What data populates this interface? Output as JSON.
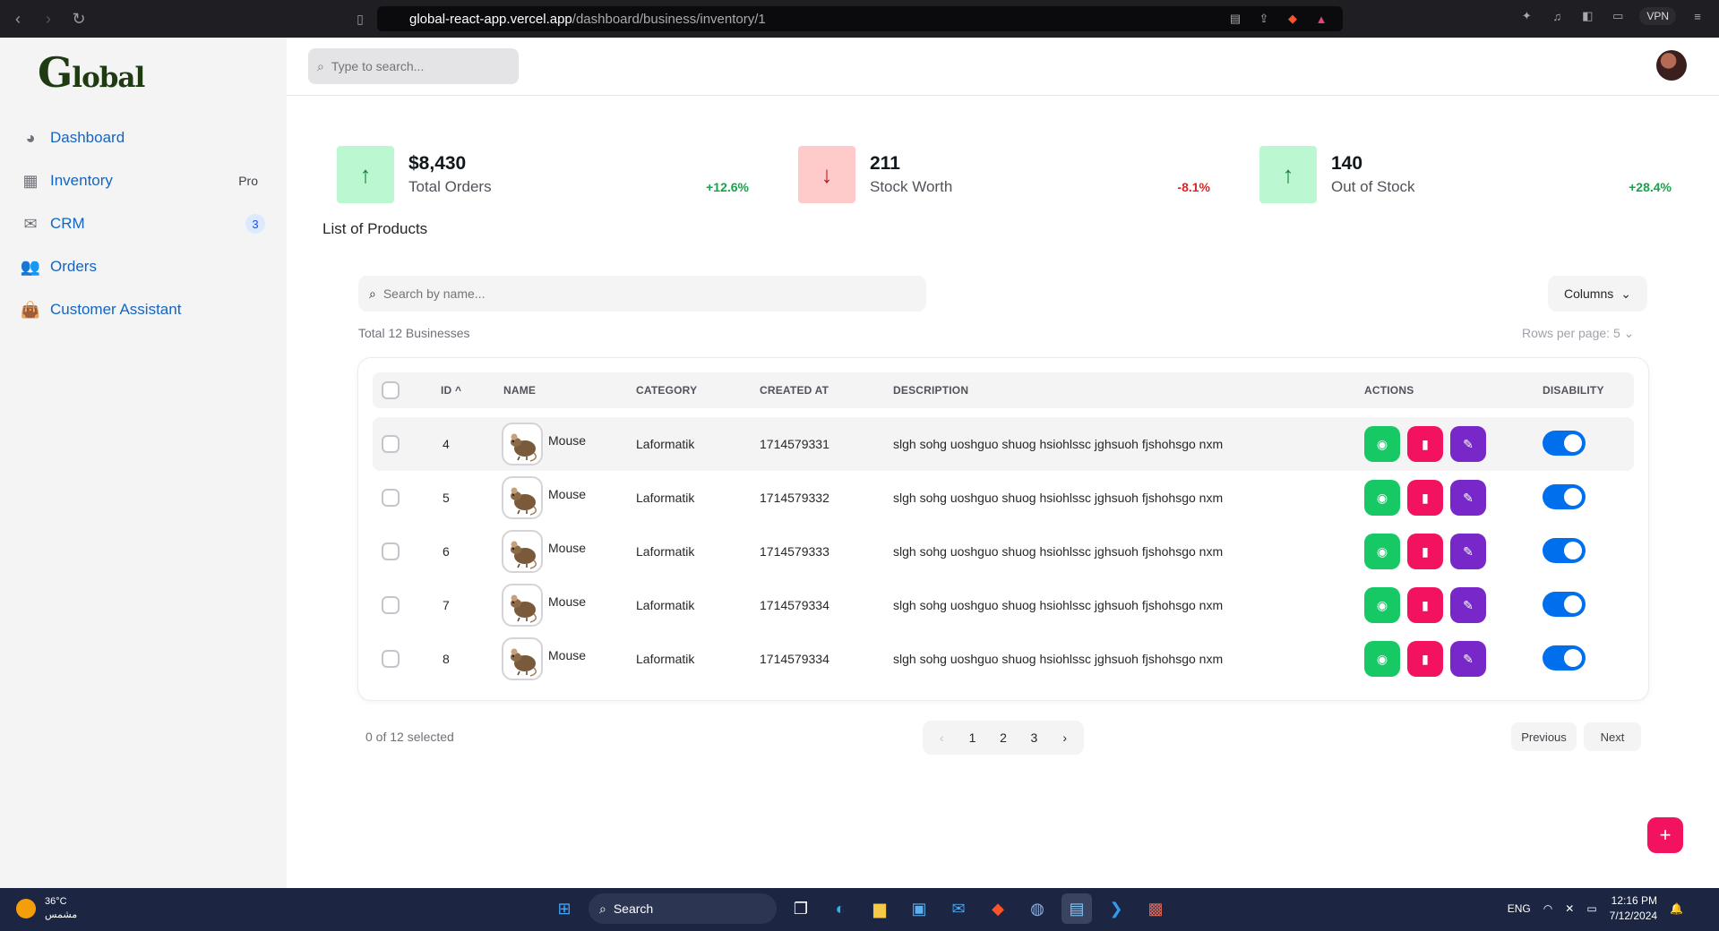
{
  "browser": {
    "url_site": "global-react-app.vercel.app",
    "url_path": "/dashboard/business/inventory/1",
    "vpn_label": "VPN"
  },
  "sidebar": {
    "logo_first": "G",
    "logo_rest": "lobal",
    "items": [
      {
        "label": "Dashboard",
        "icon": "pie-chart-icon",
        "badge": ""
      },
      {
        "label": "Inventory",
        "icon": "grid-icon",
        "badge": "Pro"
      },
      {
        "label": "CRM",
        "icon": "mailbox-icon",
        "badge": "3"
      },
      {
        "label": "Orders",
        "icon": "users-icon",
        "badge": ""
      },
      {
        "label": "Customer Assistant",
        "icon": "bag-icon",
        "badge": ""
      }
    ]
  },
  "topbar": {
    "search_placeholder": "Type to search..."
  },
  "stats": [
    {
      "value": "$8,430",
      "label": "Total Orders",
      "change": "+12.6%",
      "direction": "up"
    },
    {
      "value": "211",
      "label": "Stock Worth",
      "change": "-8.1%",
      "direction": "down"
    },
    {
      "value": "140",
      "label": "Out of Stock",
      "change": "+28.4%",
      "direction": "up"
    }
  ],
  "list_title": "List of Products",
  "table": {
    "search_placeholder": "Search by name...",
    "columns_button": "Columns",
    "total_text": "Total 12 Businesses",
    "rows_per_page_label": "Rows per page:",
    "rows_per_page_value": "5",
    "headers": {
      "id": "ID",
      "name": "NAME",
      "category": "CATEGORY",
      "created_at": "CREATED AT",
      "description": "DESCRIPTION",
      "actions": "ACTIONS",
      "disability": "DISABILITY"
    },
    "rows": [
      {
        "id": "4",
        "name": "Mouse",
        "category": "Laformatik",
        "created_at": "1714579331",
        "description": "slgh sohg uoshguo shuog hsiohlssc jghsuoh fjshohsgo nxm",
        "enabled": true
      },
      {
        "id": "5",
        "name": "Mouse",
        "category": "Laformatik",
        "created_at": "1714579332",
        "description": "slgh sohg uoshguo shuog hsiohlssc jghsuoh fjshohsgo nxm",
        "enabled": true
      },
      {
        "id": "6",
        "name": "Mouse",
        "category": "Laformatik",
        "created_at": "1714579333",
        "description": "slgh sohg uoshguo shuog hsiohlssc jghsuoh fjshohsgo nxm",
        "enabled": true
      },
      {
        "id": "7",
        "name": "Mouse",
        "category": "Laformatik",
        "created_at": "1714579334",
        "description": "slgh sohg uoshguo shuog hsiohlssc jghsuoh fjshohsgo nxm",
        "enabled": true
      },
      {
        "id": "8",
        "name": "Mouse",
        "category": "Laformatik",
        "created_at": "1714579334",
        "description": "slgh sohg uoshguo shuog hsiohlssc jghsuoh fjshohsgo nxm",
        "enabled": true
      }
    ]
  },
  "footer": {
    "selected_text": "0 of 12 selected",
    "pages": [
      "1",
      "2",
      "3"
    ],
    "previous": "Previous",
    "next": "Next",
    "fab": "+"
  },
  "taskbar": {
    "temperature": "36°C",
    "weather_desc": "مشمس",
    "search_label": "Search",
    "language": "ENG",
    "time": "12:16 PM",
    "date": "7/12/2024"
  },
  "colors": {
    "view": "#17c964",
    "delete": "#f31260",
    "edit": "#7828c8",
    "toggle_on": "#006fee",
    "sidebar_link": "#1565c0"
  }
}
